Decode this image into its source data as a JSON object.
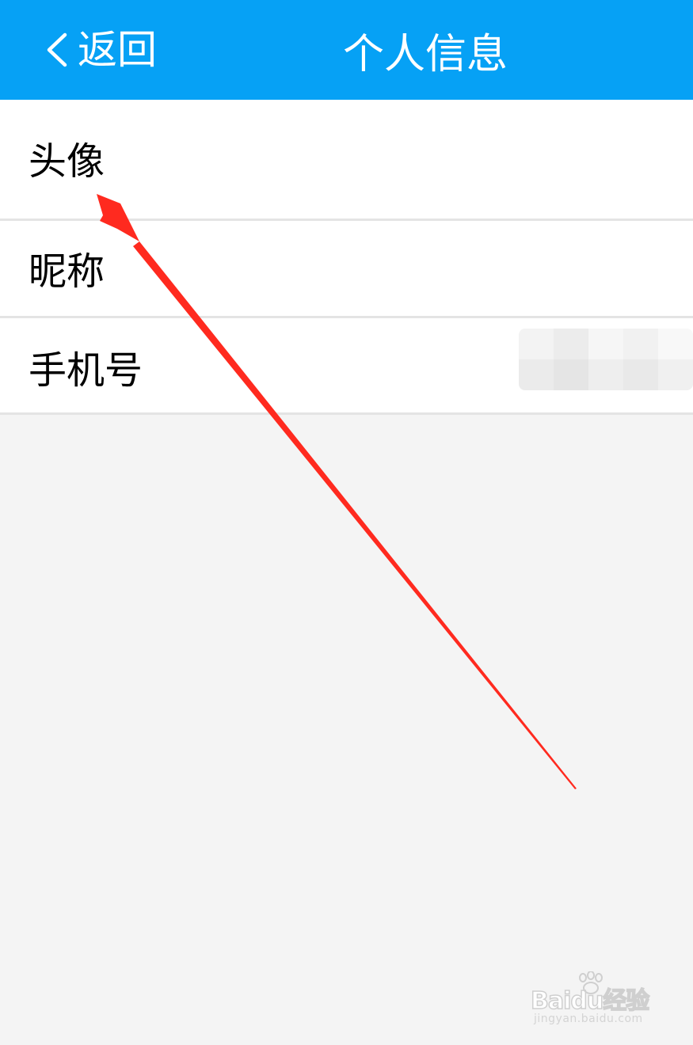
{
  "header": {
    "back_label": "返回",
    "title": "个人信息",
    "background_color": "#06a1f5",
    "back_icon": "chevron-left-icon"
  },
  "rows": [
    {
      "label": "头像"
    },
    {
      "label": "昵称"
    },
    {
      "label": "手机号",
      "value_redacted": true
    }
  ],
  "annotation": {
    "type": "arrow",
    "color": "#ff2a1f",
    "points_to": "头像"
  },
  "watermark": {
    "brand": "Baidu经验",
    "sub": "jingyan.baidu.com"
  }
}
